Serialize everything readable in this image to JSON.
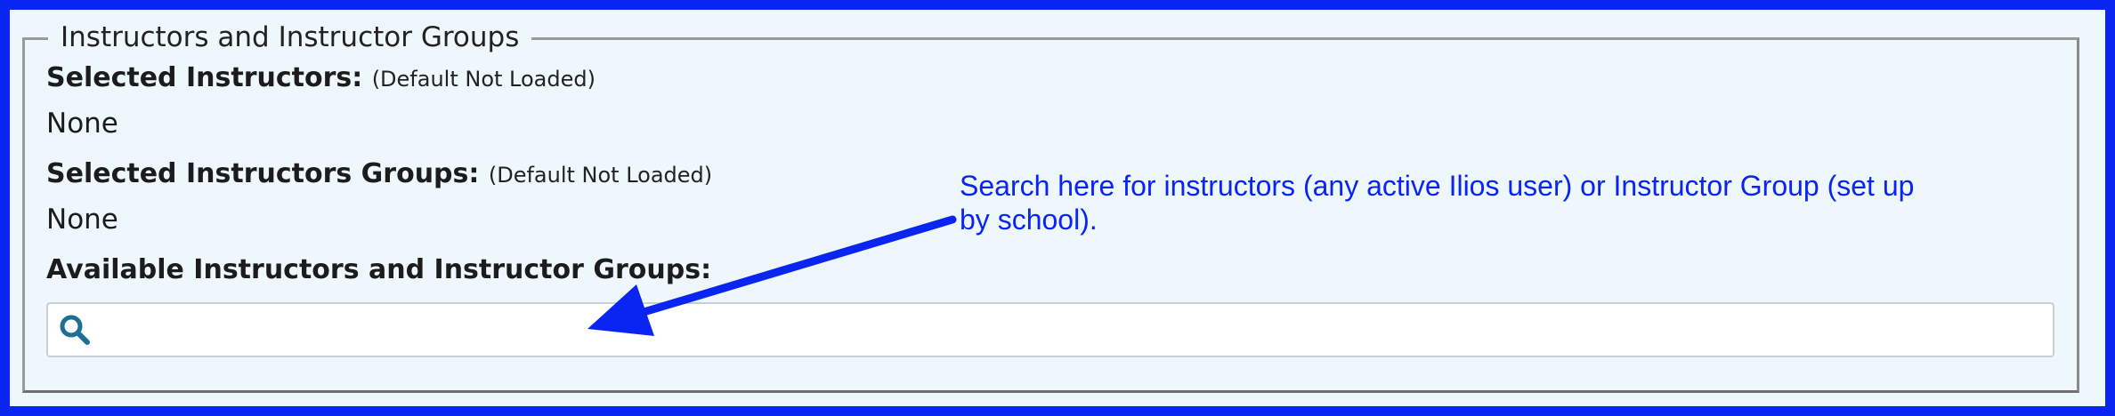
{
  "section": {
    "legend": "Instructors and Instructor Groups"
  },
  "selected_instructors": {
    "label": "Selected Instructors:",
    "note": "(Default Not Loaded)",
    "value": "None"
  },
  "selected_groups": {
    "label": "Selected Instructors Groups:",
    "note": "(Default Not Loaded)",
    "value": "None"
  },
  "available": {
    "label": "Available Instructors and Instructor Groups:",
    "search_value": "",
    "search_icon": "search-icon"
  },
  "annotation": {
    "text": "Search here for instructors (any active Ilios user) or Instructor Group (set up by school).",
    "color": "#0a24f2"
  },
  "colors": {
    "frame": "#0a24f2",
    "panel_background": "#eef8fc",
    "icon": "#1f6f95"
  }
}
